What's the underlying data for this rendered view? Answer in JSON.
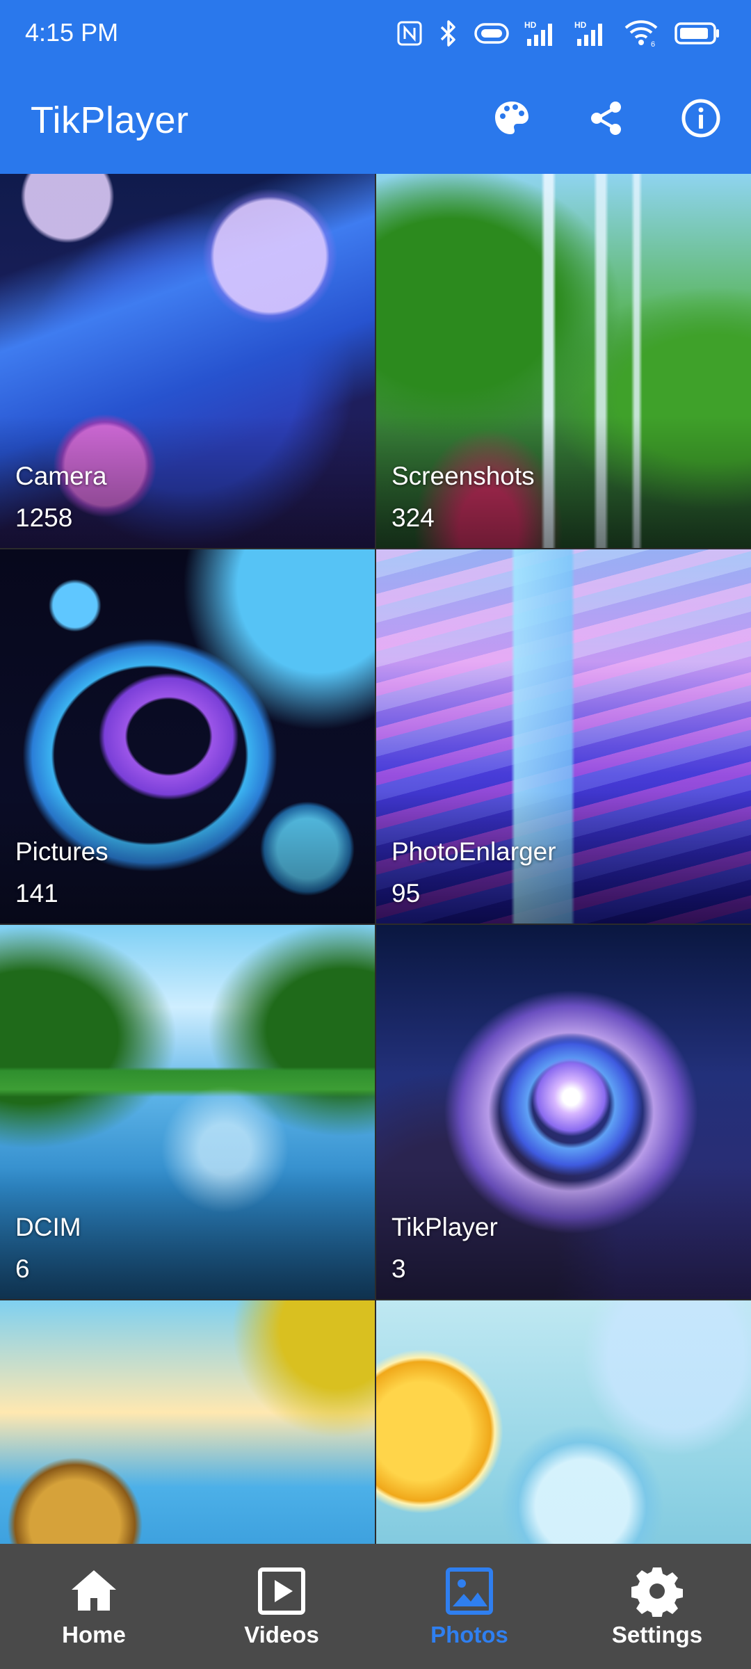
{
  "status_bar": {
    "time": "4:15 PM",
    "icons": [
      "nfc-icon",
      "bluetooth-icon",
      "hotspot-icon",
      "hd-signal-icon",
      "hd-signal-icon",
      "wifi-icon",
      "battery-icon"
    ],
    "hd_label": "HD",
    "wifi_label": "6"
  },
  "app_bar": {
    "title": "TikPlayer",
    "actions": [
      "palette-icon",
      "share-icon",
      "info-icon"
    ]
  },
  "albums": [
    {
      "name": "Camera",
      "count": "1258"
    },
    {
      "name": "Screenshots",
      "count": "324"
    },
    {
      "name": "Pictures",
      "count": "141"
    },
    {
      "name": "PhotoEnlarger",
      "count": "95"
    },
    {
      "name": "DCIM",
      "count": "6"
    },
    {
      "name": "TikPlayer",
      "count": "3"
    },
    {
      "name": "",
      "count": ""
    },
    {
      "name": "",
      "count": ""
    }
  ],
  "bottom_nav": {
    "items": [
      {
        "label": "Home",
        "icon": "home-icon",
        "active": false
      },
      {
        "label": "Videos",
        "icon": "video-icon",
        "active": false
      },
      {
        "label": "Photos",
        "icon": "image-icon",
        "active": true
      },
      {
        "label": "Settings",
        "icon": "gear-icon",
        "active": false
      }
    ]
  },
  "colors": {
    "primary": "#2a78ec",
    "nav_background": "#4a4a4a",
    "nav_active": "#2f7ff0"
  }
}
